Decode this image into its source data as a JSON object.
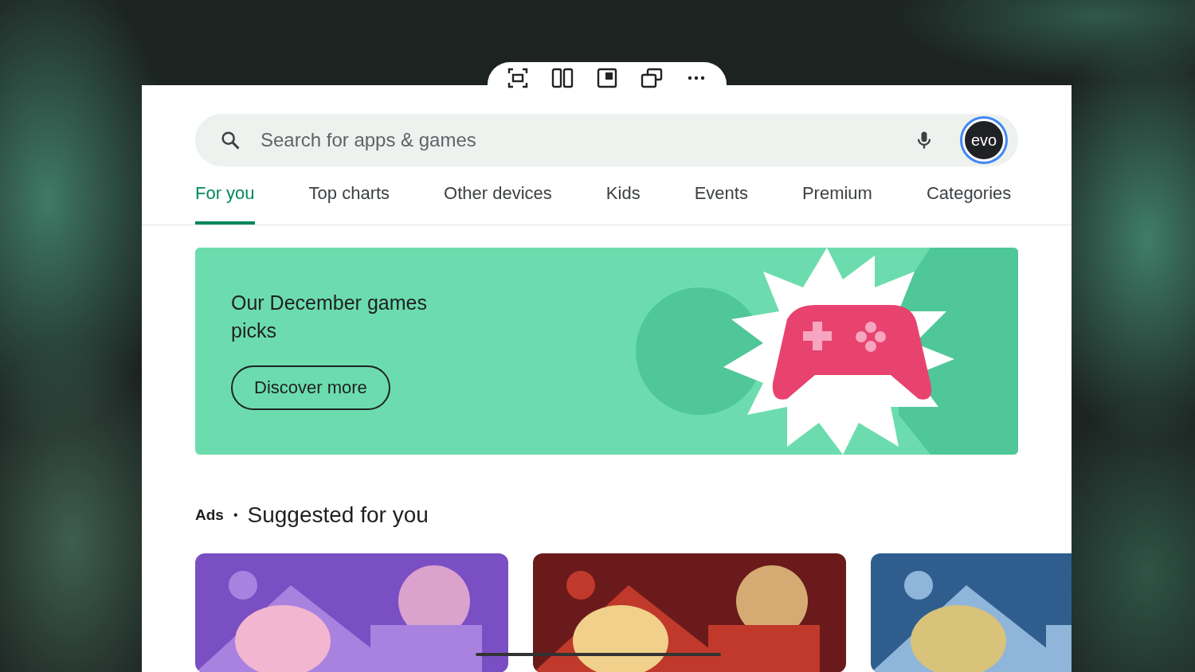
{
  "search": {
    "placeholder": "Search for apps & games"
  },
  "account": {
    "initials": "evo"
  },
  "tabs": [
    {
      "label": "For you",
      "selected": true
    },
    {
      "label": "Top charts",
      "selected": false
    },
    {
      "label": "Other devices",
      "selected": false
    },
    {
      "label": "Kids",
      "selected": false
    },
    {
      "label": "Events",
      "selected": false
    },
    {
      "label": "Premium",
      "selected": false
    },
    {
      "label": "Categories",
      "selected": false
    }
  ],
  "banner": {
    "title": "Our December games picks",
    "button": "Discover more"
  },
  "section": {
    "ads_label": "Ads",
    "separator": "•",
    "title": "Suggested for you"
  }
}
